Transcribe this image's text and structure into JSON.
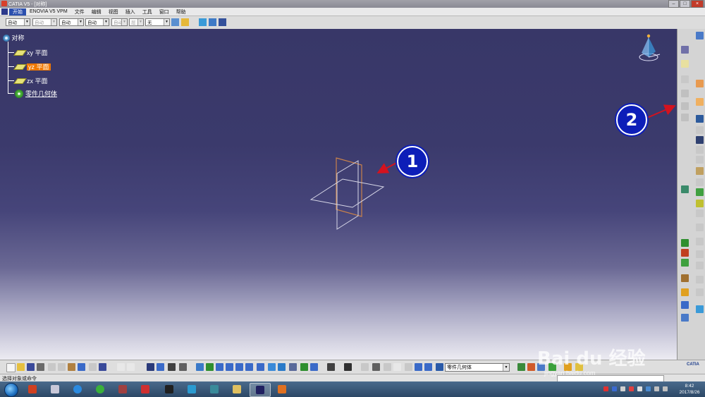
{
  "window": {
    "title": "CATIA V5 - [对称]",
    "controls": [
      "–",
      "□",
      "×"
    ]
  },
  "menu": [
    "开始",
    "ENOVIA V5 VPM",
    "文件",
    "编辑",
    "视图",
    "插入",
    "工具",
    "窗口",
    "帮助"
  ],
  "style_toolbar": {
    "combos": [
      {
        "value": "自动",
        "disabled": false
      },
      {
        "value": "自动",
        "disabled": true
      },
      {
        "value": "自动",
        "disabled": false
      },
      {
        "value": "自动",
        "disabled": false
      },
      {
        "value": "自动",
        "disabled": true
      },
      {
        "value": "层",
        "disabled": true
      },
      {
        "value": "无",
        "disabled": false
      }
    ]
  },
  "tree": {
    "root": "对称",
    "items": [
      {
        "label": "xy 平面",
        "selected": false
      },
      {
        "label": "yz 平面",
        "selected": true
      },
      {
        "label": "zx 平面",
        "selected": false
      },
      {
        "label": "零件几何体",
        "selected": false
      }
    ]
  },
  "callouts": {
    "one": "1",
    "two": "2"
  },
  "bottom_toolbar": {
    "current_body": "零件几何体",
    "logo": "CATIA"
  },
  "status": {
    "message": "选择对象或命令"
  },
  "clock": {
    "time": "8:42",
    "date": "2017/8/26"
  },
  "watermark": {
    "brand": "Bai du 经验",
    "url": "jingyan.baidu.com"
  },
  "colors": {
    "workspace_top": "#383768",
    "workspace_bottom": "#ecebf2",
    "selection": "#f07800",
    "callout": "#0d1eb8",
    "arrow": "#d4121e"
  }
}
